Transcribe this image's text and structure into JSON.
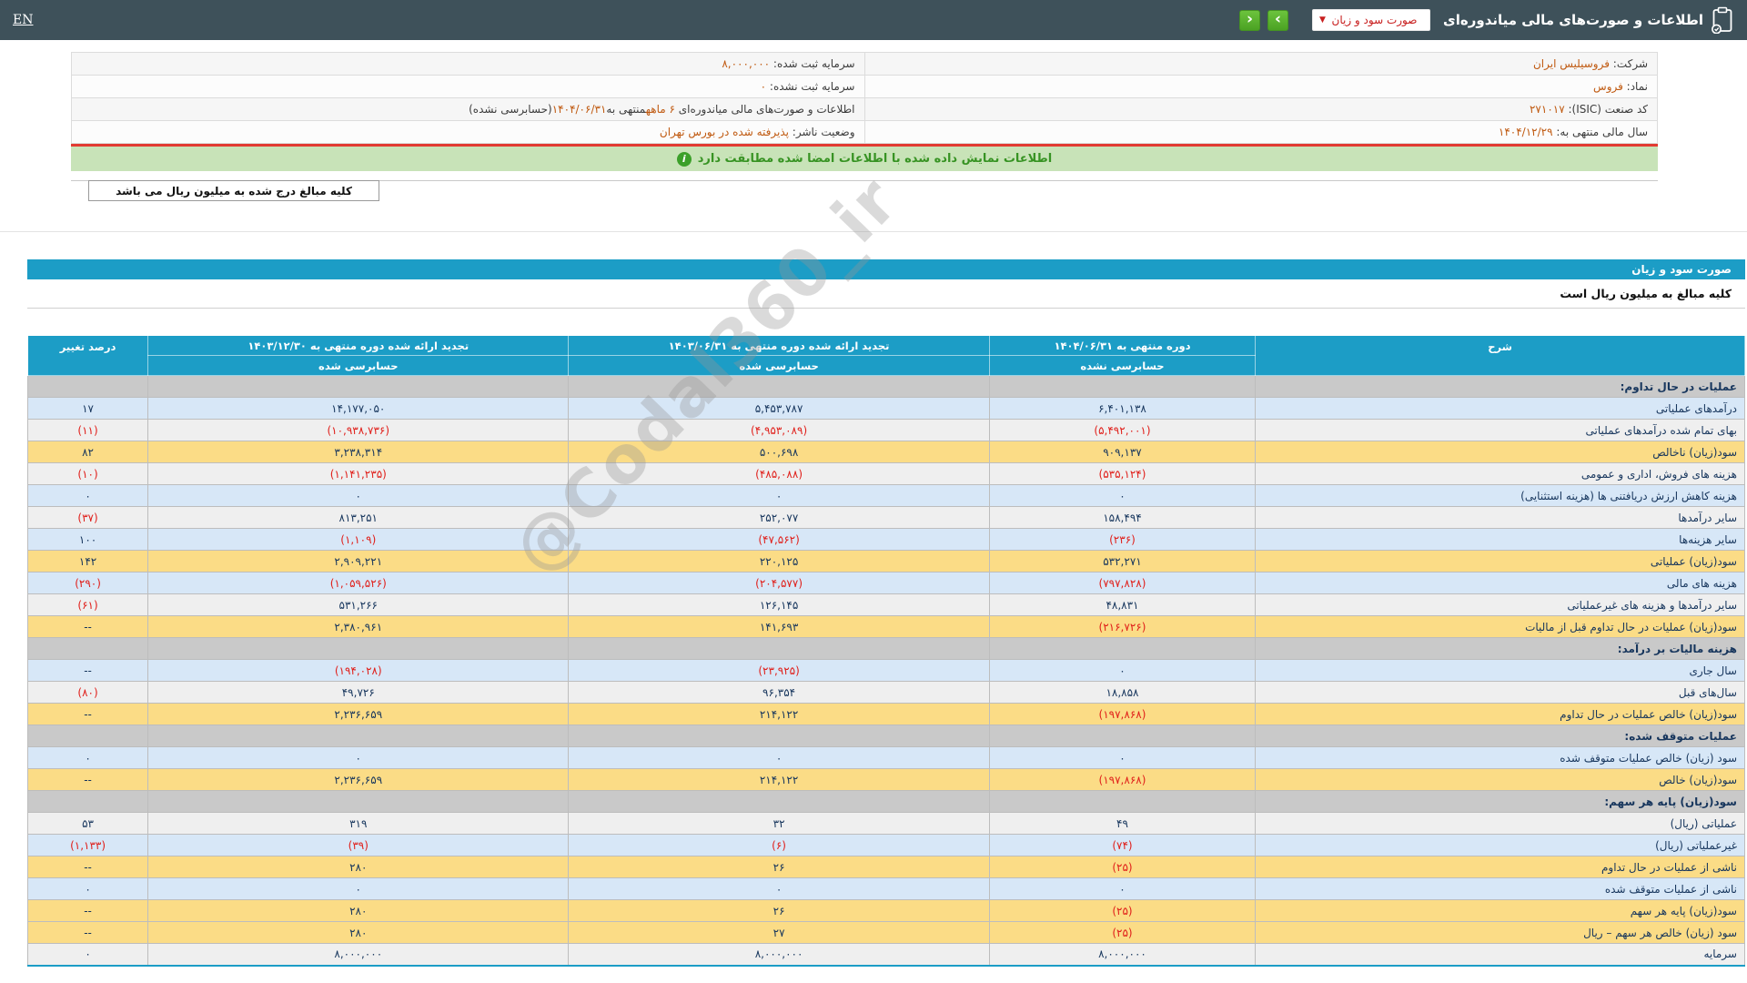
{
  "colors": {
    "accent": "#1c9dc6",
    "negative": "#e01f1a",
    "positive_text": "#17365d",
    "yellow_row": "#fbdc86",
    "blue_row": "#d7e7f7",
    "gray_row": "#efefef",
    "section_row": "#c9c9c9",
    "banner_bg": "#c8e3b8",
    "banner_text": "#379323",
    "value_orange": "#c05a11",
    "topbar_bg": "#3e515a",
    "button_green": "#53ae27",
    "select_text_red": "#c81e1e",
    "divider_red": "#e23b32"
  },
  "header": {
    "en_label": "EN",
    "title": "اطلاعات و صورت‌های مالی میاندوره‌ای",
    "statement_select": {
      "value": "صورت سود و زیان",
      "caret": "▼"
    },
    "nav_forward": "›",
    "nav_back": "‹",
    "clipboard_icon": "clipboard-check"
  },
  "company_info": {
    "rows": [
      {
        "right": [
          {
            "t": "شرکت:  "
          },
          {
            "t": "فروسیلیس ایران",
            "c": true
          }
        ],
        "left": [
          {
            "t": "سرمایه ثبت شده:  "
          },
          {
            "t": "۸,۰۰۰,۰۰۰",
            "c": true
          }
        ]
      },
      {
        "right": [
          {
            "t": "نماد:  "
          },
          {
            "t": "فروس",
            "c": true
          }
        ],
        "left": [
          {
            "t": "سرمایه ثبت نشده:  "
          },
          {
            "t": "۰",
            "c": true
          }
        ]
      },
      {
        "right": [
          {
            "t": "کد صنعت (ISIC):  "
          },
          {
            "t": "۲۷۱۰۱۷",
            "c": true
          }
        ],
        "left": [
          {
            "t": "اطلاعات و صورت‌های مالی میاندوره‌ای "
          },
          {
            "t": "۶ ماهه",
            "c": true
          },
          {
            "t": "منتهی به"
          },
          {
            "t": "۱۴۰۴/۰۶/۳۱",
            "c": true
          },
          {
            "t": "(حسابرسی نشده)"
          }
        ]
      },
      {
        "right": [
          {
            "t": "سال مالی منتهی به:  "
          },
          {
            "t": "۱۴۰۴/۱۲/۲۹",
            "c": true
          }
        ],
        "left": [
          {
            "t": "وضعیت ناشر:  "
          },
          {
            "t": "پذیرفته شده در بورس تهران",
            "c": true
          }
        ]
      }
    ]
  },
  "banner": {
    "text": "اطلاعات نمایش داده شده با اطلاعات امضا شده مطابقت دارد",
    "icon": "i"
  },
  "amounts_note": {
    "text": "کلیه مبالغ درج شده به میلیون ریال می باشد"
  },
  "report": {
    "title": "صورت سود و زیان",
    "note": "کلیه مبالغ به میلیون ریال است"
  },
  "statement": {
    "columns": {
      "desc": "شرح",
      "periods": [
        {
          "title": "دوره منتهی به ۱۴۰۴/۰۶/۳۱",
          "audit": "حسابرسی نشده"
        },
        {
          "title": "تجدید ارائه شده دوره منتهی به ۱۴۰۳/۰۶/۳۱",
          "audit": "حسابرسی شده"
        },
        {
          "title": "تجدید ارائه شده دوره منتهی به ۱۴۰۳/۱۲/۳۰",
          "audit": "حسابرسی شده"
        }
      ],
      "change": "درصد تغییر"
    },
    "rows": [
      {
        "label": "عملیات در حال تداوم:",
        "type": "section",
        "values": [
          "",
          "",
          "",
          ""
        ]
      },
      {
        "label": "درآمدهای عملیاتی",
        "type": "blue",
        "values": [
          "۶,۴۰۱,۱۳۸",
          "۵,۴۵۳,۷۸۷",
          "۱۴,۱۷۷,۰۵۰",
          "۱۷"
        ]
      },
      {
        "label": "بهای تمام شده درآمدهای عملیاتی",
        "type": "gray",
        "values": [
          "(۵,۴۹۲,۰۰۱)",
          "(۴,۹۵۳,۰۸۹)",
          "(۱۰,۹۳۸,۷۳۶)",
          "(۱۱)"
        ]
      },
      {
        "label": "سود(زیان) ناخالص",
        "type": "yellow",
        "values": [
          "۹۰۹,۱۳۷",
          "۵۰۰,۶۹۸",
          "۳,۲۳۸,۳۱۴",
          "۸۲"
        ]
      },
      {
        "label": "هزینه های فروش، اداری و عمومی",
        "type": "gray",
        "values": [
          "(۵۳۵,۱۲۴)",
          "(۴۸۵,۰۸۸)",
          "(۱,۱۴۱,۲۳۵)",
          "(۱۰)"
        ]
      },
      {
        "label": "هزینه کاهش ارزش دریافتنی ها (هزینه استثنایی)",
        "type": "blue",
        "values": [
          "۰",
          "۰",
          "۰",
          "۰"
        ]
      },
      {
        "label": "سایر درآمدها",
        "type": "gray",
        "values": [
          "۱۵۸,۴۹۴",
          "۲۵۲,۰۷۷",
          "۸۱۳,۲۵۱",
          "(۳۷)"
        ]
      },
      {
        "label": "سایر هزینه‌ها",
        "type": "blue",
        "values": [
          "(۲۳۶)",
          "(۴۷,۵۶۲)",
          "(۱,۱۰۹)",
          "۱۰۰"
        ]
      },
      {
        "label": "سود(زیان) عملیاتی",
        "type": "yellow",
        "values": [
          "۵۳۲,۲۷۱",
          "۲۲۰,۱۲۵",
          "۲,۹۰۹,۲۲۱",
          "۱۴۲"
        ]
      },
      {
        "label": "هزینه های مالی",
        "type": "blue",
        "values": [
          "(۷۹۷,۸۲۸)",
          "(۲۰۴,۵۷۷)",
          "(۱,۰۵۹,۵۲۶)",
          "(۲۹۰)"
        ]
      },
      {
        "label": "سایر درآمدها و هزینه های غیرعملیاتی",
        "type": "gray",
        "values": [
          "۴۸,۸۳۱",
          "۱۲۶,۱۴۵",
          "۵۳۱,۲۶۶",
          "(۶۱)"
        ]
      },
      {
        "label": "سود(زیان) عملیات در حال تداوم قبل از مالیات",
        "type": "yellow",
        "values": [
          "(۲۱۶,۷۲۶)",
          "۱۴۱,۶۹۳",
          "۲,۳۸۰,۹۶۱",
          "--"
        ]
      },
      {
        "label": "هزینه مالیات بر درآمد:",
        "type": "section",
        "values": [
          "",
          "",
          "",
          ""
        ]
      },
      {
        "label": "سال جاری",
        "type": "blue",
        "values": [
          "۰",
          "(۲۳,۹۲۵)",
          "(۱۹۴,۰۲۸)",
          "--"
        ]
      },
      {
        "label": "سال‌های قبل",
        "type": "gray",
        "values": [
          "۱۸,۸۵۸",
          "۹۶,۳۵۴",
          "۴۹,۷۲۶",
          "(۸۰)"
        ]
      },
      {
        "label": "سود(زیان) خالص عملیات در حال تداوم",
        "type": "yellow",
        "values": [
          "(۱۹۷,۸۶۸)",
          "۲۱۴,۱۲۲",
          "۲,۲۳۶,۶۵۹",
          "--"
        ]
      },
      {
        "label": "عملیات متوقف شده:",
        "type": "section",
        "values": [
          "",
          "",
          "",
          ""
        ]
      },
      {
        "label": "سود (زیان) خالص عملیات متوقف شده",
        "type": "blue",
        "values": [
          "۰",
          "۰",
          "۰",
          "۰"
        ]
      },
      {
        "label": "سود(زیان) خالص",
        "type": "yellow",
        "values": [
          "(۱۹۷,۸۶۸)",
          "۲۱۴,۱۲۲",
          "۲,۲۳۶,۶۵۹",
          "--"
        ]
      },
      {
        "label": "سود(زیان) پایه هر سهم:",
        "type": "section",
        "values": [
          "",
          "",
          "",
          ""
        ]
      },
      {
        "label": "عملیاتی (ریال)",
        "type": "gray",
        "values": [
          "۴۹",
          "۳۲",
          "۳۱۹",
          "۵۳"
        ]
      },
      {
        "label": "غیرعملیاتی (ریال)",
        "type": "blue",
        "values": [
          "(۷۴)",
          "(۶)",
          "(۳۹)",
          "(۱,۱۳۳)"
        ]
      },
      {
        "label": "ناشی از عملیات در حال تداوم",
        "type": "yellow",
        "values": [
          "(۲۵)",
          "۲۶",
          "۲۸۰",
          "--"
        ]
      },
      {
        "label": "ناشی از عملیات متوقف شده",
        "type": "blue",
        "values": [
          "۰",
          "۰",
          "۰",
          "۰"
        ]
      },
      {
        "label": "سود(زیان) پایه هر سهم",
        "type": "yellow",
        "values": [
          "(۲۵)",
          "۲۶",
          "۲۸۰",
          "--"
        ]
      },
      {
        "label": "سود (زیان) خالص هر سهم – ریال",
        "type": "yellow",
        "values": [
          "(۲۵)",
          "۲۷",
          "۲۸۰",
          "--"
        ]
      },
      {
        "label": "سرمایه",
        "type": "gray",
        "values": [
          "۸,۰۰۰,۰۰۰",
          "۸,۰۰۰,۰۰۰",
          "۸,۰۰۰,۰۰۰",
          "۰"
        ]
      }
    ]
  },
  "watermark": "@Codal360_ir"
}
